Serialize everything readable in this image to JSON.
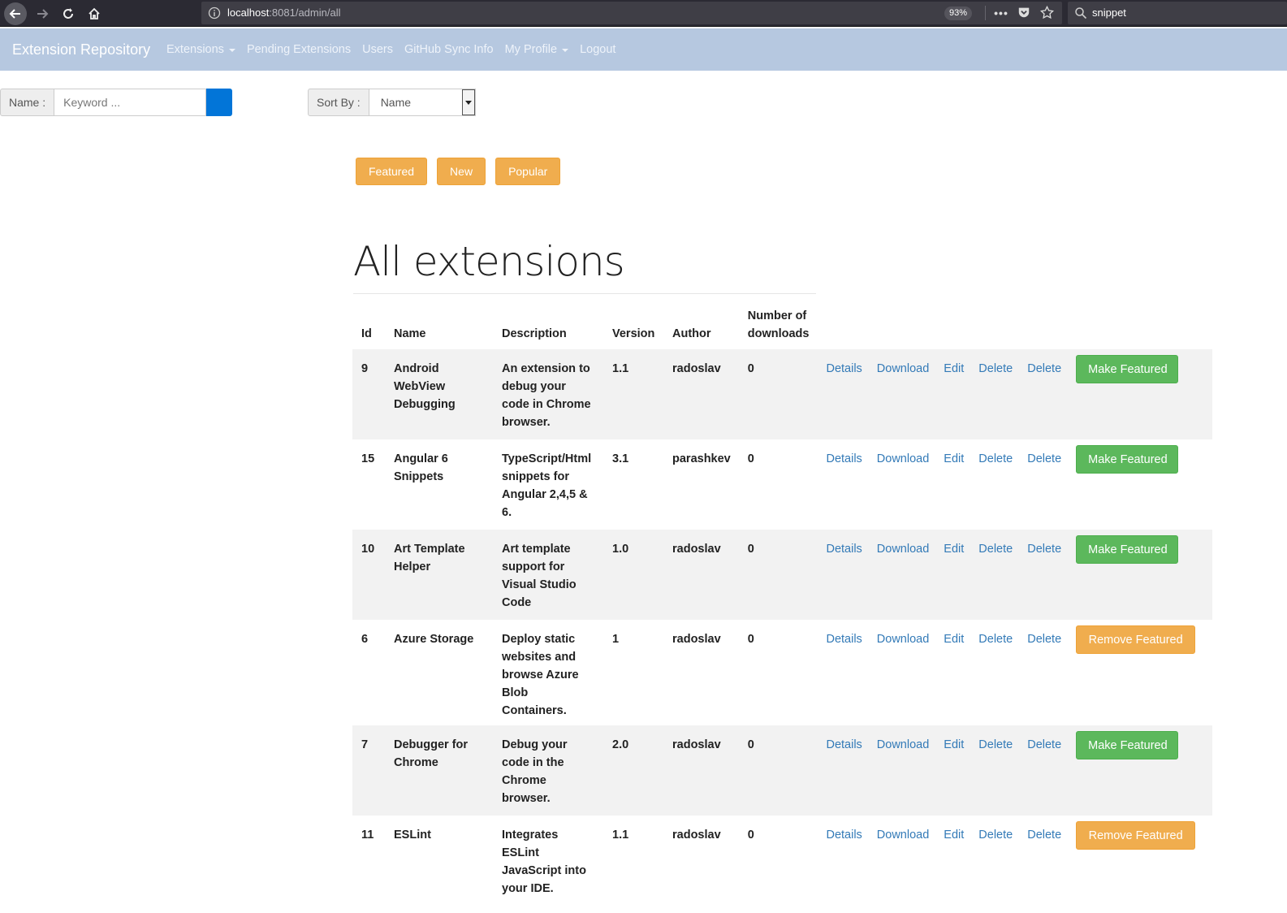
{
  "browser": {
    "url_host": "localhost",
    "url_rest": ":8081/admin/all",
    "zoom": "93%",
    "search_value": "snippet"
  },
  "navbar": {
    "brand": "Extension Repository",
    "items": [
      {
        "label": "Extensions",
        "dropdown": true
      },
      {
        "label": "Pending Extensions",
        "dropdown": false
      },
      {
        "label": "Users",
        "dropdown": false
      },
      {
        "label": "GitHub Sync Info",
        "dropdown": false
      },
      {
        "label": "My Profile",
        "dropdown": true
      },
      {
        "label": "Logout",
        "dropdown": false
      }
    ]
  },
  "search": {
    "name_label": "Name :",
    "placeholder": "Keyword ...",
    "sort_label": "Sort By :",
    "sort_value": "Name"
  },
  "filters": [
    "Featured",
    "New",
    "Popular"
  ],
  "page": {
    "title": "All extensions"
  },
  "table": {
    "headers": {
      "id": "Id",
      "name": "Name",
      "description": "Description",
      "version": "Version",
      "author": "Author",
      "downloads": "Number of downloads"
    },
    "action_labels": {
      "details": "Details",
      "download": "Download",
      "edit": "Edit",
      "delete": "Delete"
    },
    "rows": [
      {
        "id": "9",
        "name": "Android WebView Debugging",
        "description": "An extension to debug your code in Chrome browser.",
        "version": "1.1",
        "author": "radoslav",
        "downloads": "0",
        "feature_label": "Make Featured",
        "featured": false
      },
      {
        "id": "15",
        "name": "Angular 6 Snippets",
        "description": "TypeScript/Html snippets for Angular 2,4,5 & 6.",
        "version": "3.1",
        "author": "parashkev",
        "downloads": "0",
        "feature_label": "Make Featured",
        "featured": false
      },
      {
        "id": "10",
        "name": "Art Template Helper",
        "description": "Art template support for Visual Studio Code",
        "version": "1.0",
        "author": "radoslav",
        "downloads": "0",
        "feature_label": "Make Featured",
        "featured": false
      },
      {
        "id": "6",
        "name": "Azure Storage",
        "description": "Deploy static websites and browse Azure Blob Containers.",
        "version": "1",
        "author": "radoslav",
        "downloads": "0",
        "feature_label": "Remove Featured",
        "featured": true
      },
      {
        "id": "7",
        "name": "Debugger for Chrome",
        "description": "Debug your code in the Chrome browser.",
        "version": "2.0",
        "author": "radoslav",
        "downloads": "0",
        "feature_label": "Make Featured",
        "featured": false
      },
      {
        "id": "11",
        "name": "ESLint",
        "description": "Integrates ESLint JavaScript into your IDE.",
        "version": "1.1",
        "author": "radoslav",
        "downloads": "0",
        "feature_label": "Remove Featured",
        "featured": true
      }
    ]
  },
  "colors": {
    "navbar_bg": "#b6c8e0",
    "link": "#337ab7",
    "success": "#5cb85c",
    "warning": "#f0ad4e",
    "primary": "#0275d8"
  }
}
